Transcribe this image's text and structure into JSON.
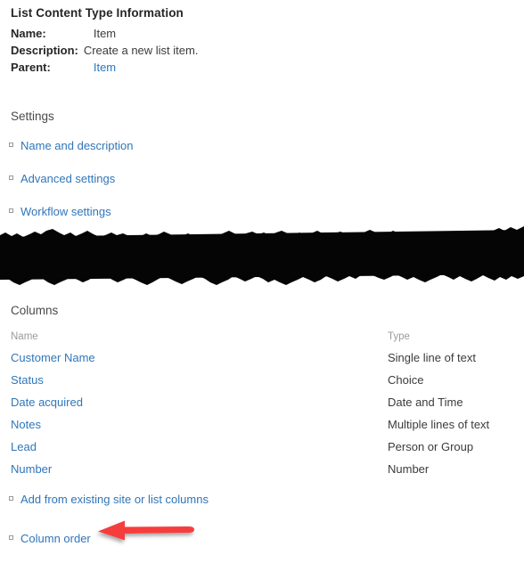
{
  "page": {
    "title": "List Content Type Information"
  },
  "info": {
    "rows": [
      {
        "label": "Name:",
        "value": "Item",
        "is_link": false
      },
      {
        "label": "Description:",
        "value": "Create a new list item.",
        "is_link": false
      },
      {
        "label": "Parent:",
        "value": "Item",
        "is_link": true
      }
    ]
  },
  "settings": {
    "heading": "Settings",
    "links": [
      {
        "label": "Name and description",
        "bullet": "square-bullet-icon"
      },
      {
        "label": "Advanced settings",
        "bullet": "square-bullet-icon"
      },
      {
        "label": "Workflow settings",
        "bullet": "square-bullet-icon"
      }
    ]
  },
  "redaction": {
    "present": true,
    "color": "#000000",
    "description": "black marker scribble covering content"
  },
  "columns": {
    "heading": "Columns",
    "headers": {
      "name": "Name",
      "type": "Type"
    },
    "rows": [
      {
        "name": "Customer Name",
        "type": "Single line of text"
      },
      {
        "name": "Status",
        "type": "Choice"
      },
      {
        "name": "Date acquired",
        "type": "Date and Time"
      },
      {
        "name": "Notes",
        "type": "Multiple lines of text"
      },
      {
        "name": "Lead",
        "type": "Person or Group"
      },
      {
        "name": "Number",
        "type": "Number"
      }
    ],
    "bottom_links": [
      {
        "label": "Add from existing site or list columns",
        "bullet": "square-bullet-icon"
      },
      {
        "label": "Column order",
        "bullet": "square-bullet-icon"
      }
    ]
  },
  "annotation": {
    "arrow": {
      "name": "red-arrow-icon",
      "direction": "left",
      "color": "#f63e3e",
      "points_at": "Column order"
    }
  },
  "colors": {
    "link": "#2f76ba",
    "heading": "#4a4a4a",
    "title": "#262626",
    "table_header": "#9b9b9b",
    "accent_red": "#f63e3e",
    "background": "#ffffff"
  }
}
